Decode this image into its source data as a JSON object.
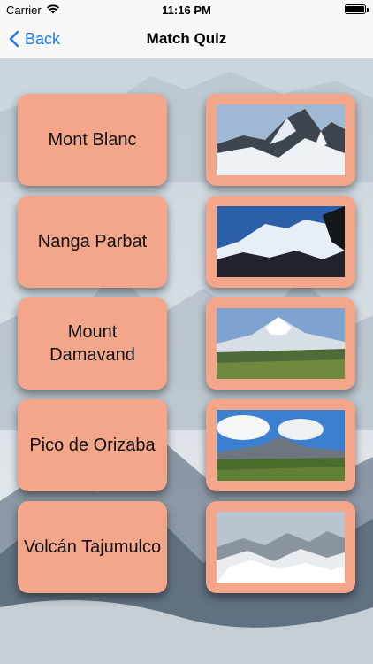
{
  "status": {
    "carrier": "Carrier",
    "time": "11:16 PM"
  },
  "nav": {
    "back_label": "Back",
    "title": "Match Quiz"
  },
  "tiles": {
    "names": [
      "Mont Blanc",
      "Nanga Parbat",
      "Mount Damavand",
      "Pico de Orizaba",
      "Volcán Tajumulco"
    ],
    "photos": [
      "mountain-photo-1",
      "mountain-photo-2",
      "mountain-photo-3",
      "mountain-photo-4",
      "mountain-photo-5"
    ]
  },
  "colors": {
    "tile": "#f4a68b",
    "accent": "#1a7cf5"
  }
}
